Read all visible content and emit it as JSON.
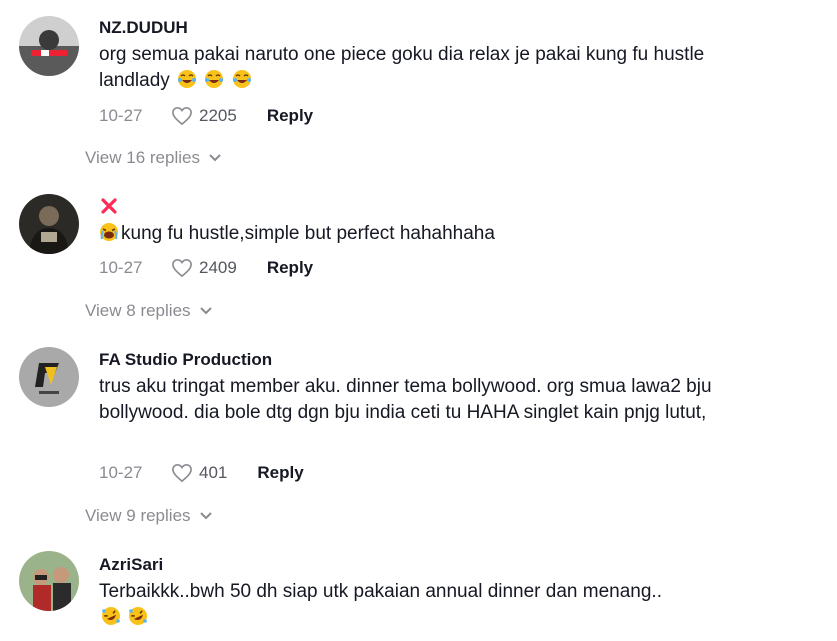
{
  "comments": [
    {
      "username": "NZ.DUDUH",
      "text": "org semua pakai naruto one piece goku dia relax je pakai kung fu hustle landlady",
      "emoji_after": [
        "laughing-face-icon",
        "laughing-face-icon",
        "laughing-face-icon"
      ],
      "date": "10-27",
      "likes": "2205",
      "reply_label": "Reply",
      "view_replies": "View 16 replies"
    },
    {
      "username": "❌",
      "text": "kung fu hustle,simple but perfect hahahhaha",
      "emoji_before": [
        "loudly-laughing-face-icon"
      ],
      "date": "10-27",
      "likes": "2409",
      "reply_label": "Reply",
      "view_replies": "View 8 replies"
    },
    {
      "username": "FA Studio Production",
      "text": "trus aku tringat member aku. dinner tema bollywood. org smua lawa2 bju bollywood. dia bole dtg dgn bju india ceti tu HAHA singlet kain pnjg lutut,",
      "date": "10-27",
      "likes": "401",
      "reply_label": "Reply",
      "view_replies": "View 9 replies"
    },
    {
      "username": "AzriSari",
      "text": "Terbaikkk..bwh 50 dh siap utk pakaian annual dinner dan menang..",
      "emoji_after": [
        "rolling-laughing-face-icon",
        "rolling-laughing-face-icon"
      ]
    }
  ],
  "colors": {
    "text": "#161823",
    "muted": "#8a8b91",
    "x_mark": "#fe2c55"
  }
}
